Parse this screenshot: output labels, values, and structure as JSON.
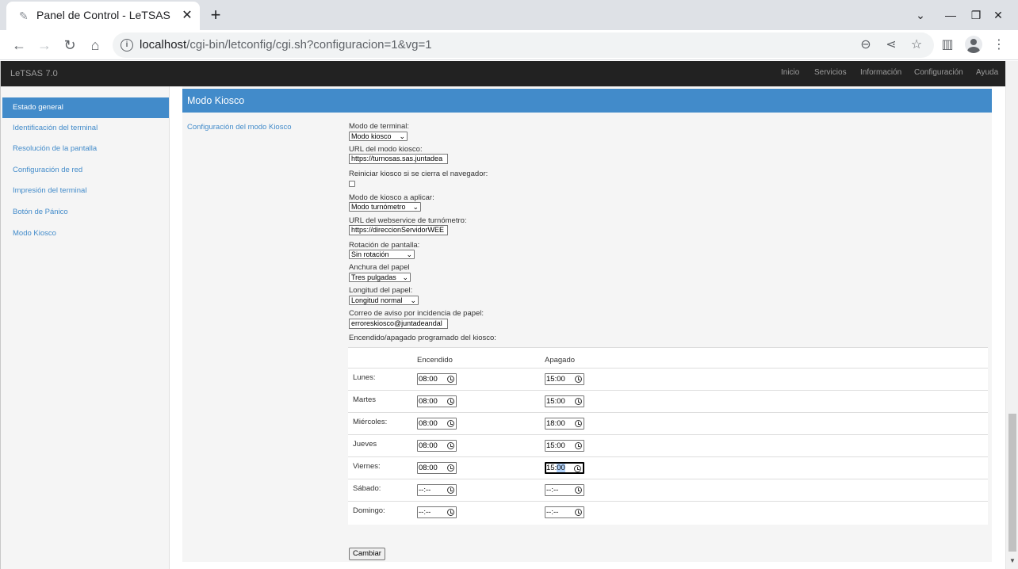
{
  "browser": {
    "tab_title": "Panel de Control - LeTSAS",
    "url_host": "localhost",
    "url_path": "/cgi-bin/letconfig/cgi.sh?configuracion=1&vg=1"
  },
  "navbar": {
    "brand": "LeTSAS",
    "version": "7.0",
    "links": [
      "Inicio",
      "Servicios",
      "Información",
      "Configuración",
      "Ayuda"
    ]
  },
  "sidebar": {
    "items": [
      {
        "label": "Estado general",
        "active": true
      },
      {
        "label": "Identificación del terminal"
      },
      {
        "label": "Resolución de la pantalla"
      },
      {
        "label": "Configuración de red"
      },
      {
        "label": "Impresión del terminal"
      },
      {
        "label": "Botón de Pánico"
      },
      {
        "label": "Modo Kiosco"
      }
    ]
  },
  "section": {
    "title": "Modo Kiosco",
    "subtitle": "Configuración del modo Kiosco"
  },
  "form": {
    "terminal_mode_label": "Modo de terminal:",
    "terminal_mode_value": "Modo kiosco",
    "kiosk_url_label": "URL del modo kiosco:",
    "kiosk_url_value": "https://turnosas.sas.juntadea",
    "restart_label": "Reiniciar kiosco si se cierra el navegador:",
    "kiosk_mode_label": "Modo de kiosco a aplicar:",
    "kiosk_mode_value": "Modo turnómetro",
    "webservice_label": "URL del webservice de turnómetro:",
    "webservice_value": "https://direccionServidorWEE",
    "rotation_label": "Rotación de pantalla:",
    "rotation_value": "Sin rotación",
    "paper_width_label": "Anchura del papel",
    "paper_width_value": "Tres pulgadas",
    "paper_length_label": "Longitud del papel:",
    "paper_length_value": "Longitud normal",
    "email_label": "Correo de aviso por incidencia de papel:",
    "email_value": "erroreskiosco@juntadeandal",
    "schedule_label": "Encendido/apagado programado del kiosco:",
    "submit_label": "Cambiar"
  },
  "schedule": {
    "col_on": "Encendido",
    "col_off": "Apagado",
    "rows": [
      {
        "day": "Lunes:",
        "on": "08:00",
        "off": "15:00"
      },
      {
        "day": "Martes",
        "on": "08:00",
        "off": "15:00"
      },
      {
        "day": "Miércoles:",
        "on": "08:00",
        "off": "18:00"
      },
      {
        "day": "Jueves",
        "on": "08:00",
        "off": "15:00"
      },
      {
        "day": "Viernes:",
        "on": "08:00",
        "off_hour": "15",
        "off_sep": ":",
        "off_min": "00"
      },
      {
        "day": "Sábado:",
        "on": "--:--",
        "off": "--:--"
      },
      {
        "day": "Domingo:",
        "on": "--:--",
        "off": "--:--"
      }
    ]
  }
}
